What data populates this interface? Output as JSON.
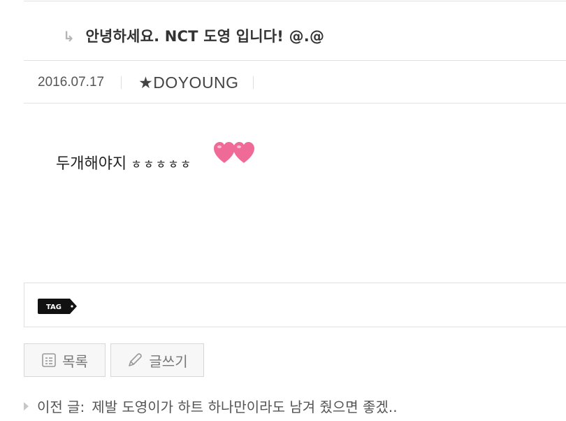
{
  "post": {
    "reply_arrow": "↳",
    "title": "안녕하세요. NCT 도영 입니다! @.@",
    "date": "2016.07.17",
    "author": "★DOYOUNG",
    "body_text": "두개해야지",
    "body_laugh": "ㅎㅎㅎㅎㅎ"
  },
  "tags": {
    "badge_label": "TAG"
  },
  "buttons": {
    "list_label": "목록",
    "write_label": "글쓰기"
  },
  "prev_post": {
    "label": "이전 글:",
    "title": "제발 도영이가 하트 하나만이라도 남겨 줬으면 좋겠.."
  },
  "colors": {
    "heart": "#f06a98",
    "badge_bg": "#111111",
    "divider": "#e2e2e2",
    "button_bg": "#f7f7f7"
  }
}
